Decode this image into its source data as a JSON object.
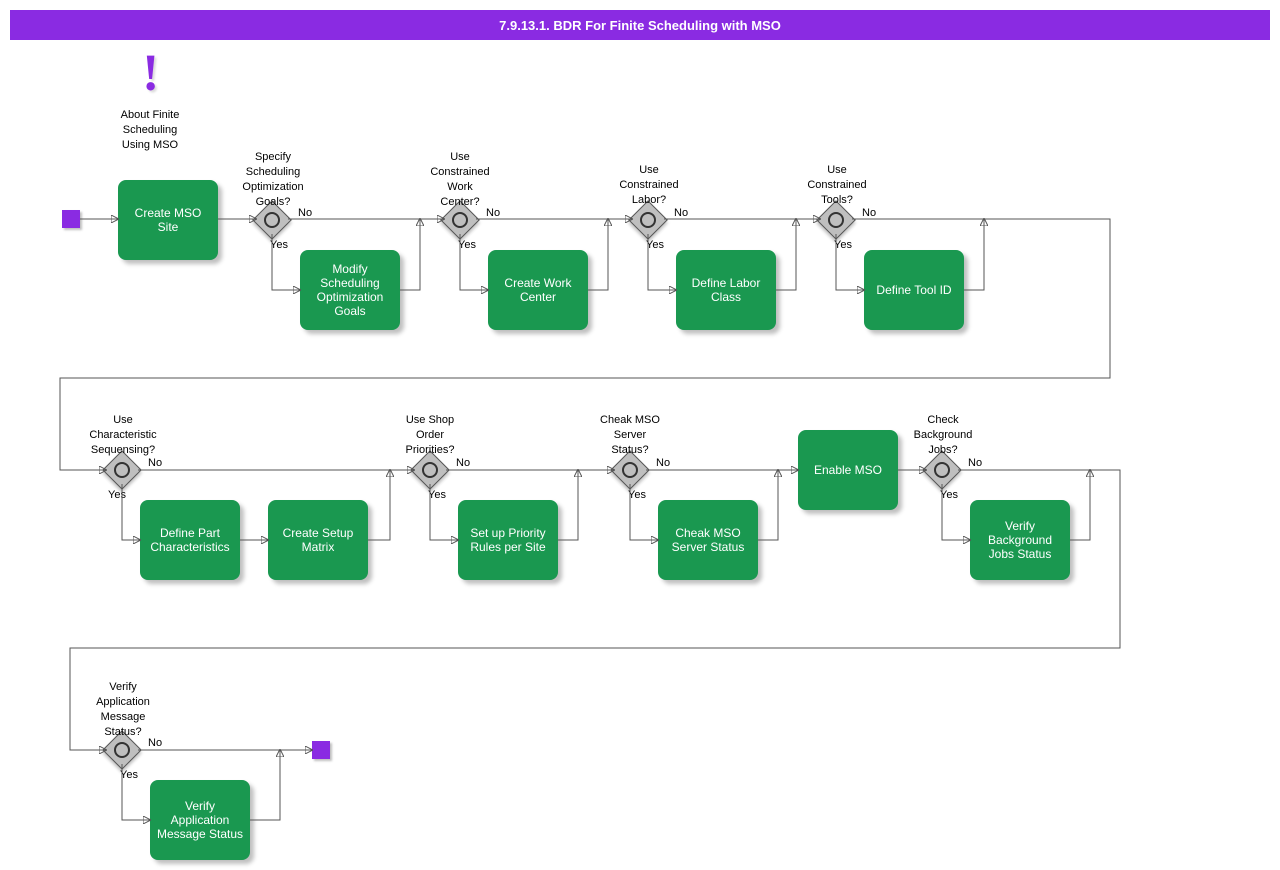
{
  "header": {
    "title": "7.9.13.1. BDR For Finite Scheduling with MSO"
  },
  "annotation": {
    "text": "About Finite\nScheduling\nUsing MSO"
  },
  "row1": {
    "task0": "Create MSO Site",
    "g1": {
      "q": "Specify\nScheduling\nOptimization\nGoals?",
      "yes": "Yes",
      "no": "No",
      "task": "Modify\nScheduling\nOptimization\nGoals"
    },
    "g2": {
      "q": "Use\nConstrained\nWork\nCenter?",
      "yes": "Yes",
      "no": "No",
      "task": "Create Work\nCenter"
    },
    "g3": {
      "q": "Use\nConstrained\nLabor?",
      "yes": "Yes",
      "no": "No",
      "task": "Define Labor\nClass"
    },
    "g4": {
      "q": "Use\nConstrained\nTools?",
      "yes": "Yes",
      "no": "No",
      "task": "Define Tool ID"
    }
  },
  "row2": {
    "g5": {
      "q": "Use\nCharacteristic\nSequensing?",
      "yes": "Yes",
      "no": "No",
      "taskA": "Define Part\nCharacteristics",
      "taskB": "Create Setup\nMatrix"
    },
    "g6": {
      "q": "Use Shop\nOrder\nPriorities?",
      "yes": "Yes",
      "no": "No",
      "task": "Set up Priority\nRules per Site"
    },
    "g7": {
      "q": "Cheak MSO\nServer\nStatus?",
      "yes": "Yes",
      "no": "No",
      "task": "Cheak MSO\nServer Status"
    },
    "task8": "Enable MSO",
    "g8": {
      "q": "Check\nBackground\nJobs?",
      "yes": "Yes",
      "no": "No",
      "task": "Verify\nBackground\nJobs Status"
    }
  },
  "row3": {
    "g9": {
      "q": "Verify\nApplication\nMessage\nStatus?",
      "yes": "Yes",
      "no": "No",
      "task": "Verify Application\nMessage Status"
    }
  }
}
